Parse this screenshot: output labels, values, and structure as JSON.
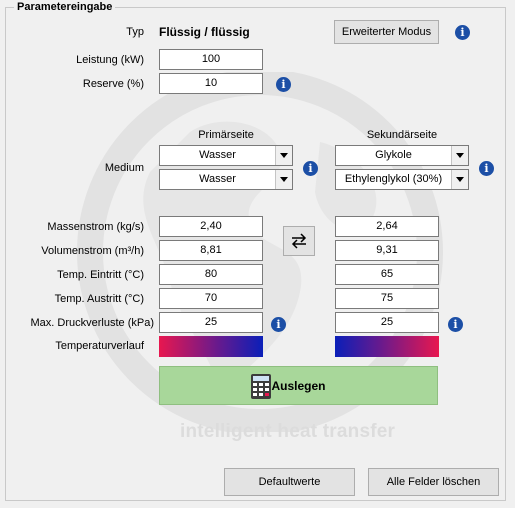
{
  "section_title": "Parametereingabe",
  "watermark": "intelligent heat transfer",
  "typ": {
    "label": "Typ",
    "value": "Flüssig / flüssig"
  },
  "extended_mode_button": "Erweiterter Modus",
  "leistung": {
    "label": "Leistung (kW)",
    "value": "100"
  },
  "reserve": {
    "label": "Reserve (%)",
    "value": "10"
  },
  "columns": {
    "primary": "Primärseite",
    "secondary": "Sekundärseite"
  },
  "medium": {
    "label": "Medium",
    "primary": [
      "Wasser",
      "Wasser"
    ],
    "secondary": [
      "Glykole",
      "Ethylenglykol (30%)"
    ]
  },
  "swap_icon": "swap-arrows-icon",
  "params": [
    {
      "label": "Massenstrom (kg/s)",
      "primary": "2,40",
      "secondary": "2,64"
    },
    {
      "label": "Volumenstrom (m³/h)",
      "primary": "8,81",
      "secondary": "9,31"
    },
    {
      "label": "Temp. Eintritt (°C)",
      "primary": "80",
      "secondary": "65"
    },
    {
      "label": "Temp. Austritt (°C)",
      "primary": "70",
      "secondary": "75"
    },
    {
      "label": "Max. Druckverluste (kPa)",
      "primary": "25",
      "secondary": "25"
    }
  ],
  "temperaturverlauf": {
    "label": "Temperaturverlauf"
  },
  "calculate_button": "Auslegen",
  "default_button": "Defaultwerte",
  "clear_button": "Alle Felder löschen",
  "colors": {
    "info": "#1c4fa6",
    "calc_button": "#a8d79a",
    "hot": "#e8174f",
    "cold": "#0a1fb8"
  }
}
